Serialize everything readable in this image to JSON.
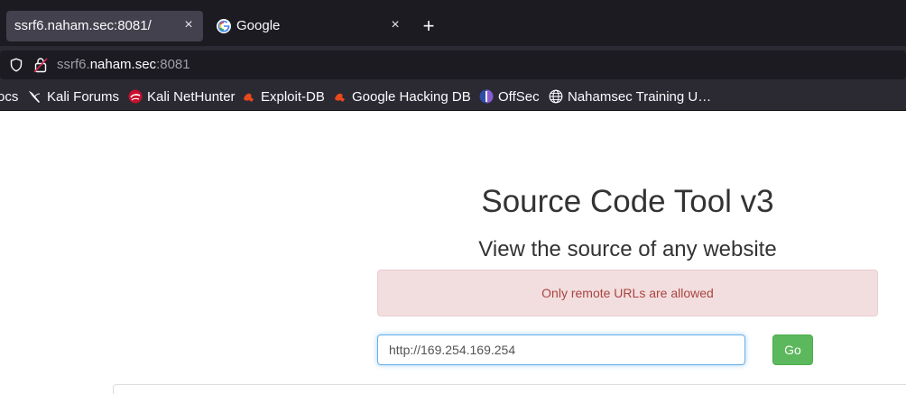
{
  "tabs": [
    {
      "title": "ssrf6.naham.sec:8081/",
      "active": true
    },
    {
      "title": "Google",
      "active": false,
      "favicon": "google-icon"
    }
  ],
  "newtab_label": "+",
  "close_glyph": "×",
  "urlbar": {
    "prefix": "ssrf6.",
    "host": "naham.sec",
    "suffix": ":8081"
  },
  "bookmarks": [
    {
      "label": "ocs",
      "icon": ""
    },
    {
      "label": "Kali Forums",
      "icon": "kali-dragon-icon"
    },
    {
      "label": "Kali NetHunter",
      "icon": "nethunter-icon"
    },
    {
      "label": "Exploit-DB",
      "icon": "exploit-db-icon"
    },
    {
      "label": "Google Hacking DB",
      "icon": "ghdb-icon"
    },
    {
      "label": "OffSec",
      "icon": "offsec-icon"
    },
    {
      "label": "Nahamsec Training U…",
      "icon": "globe-icon"
    }
  ],
  "page": {
    "title": "Source Code Tool v3",
    "subtitle": "View the source of any website",
    "alert": "Only remote URLs are allowed",
    "url_value": "http://169.254.169.254",
    "go_label": "Go"
  },
  "colors": {
    "alert_bg": "#f2dede",
    "alert_text": "#a94442",
    "go_bg": "#5cb85c",
    "input_focus": "#66afe9"
  }
}
